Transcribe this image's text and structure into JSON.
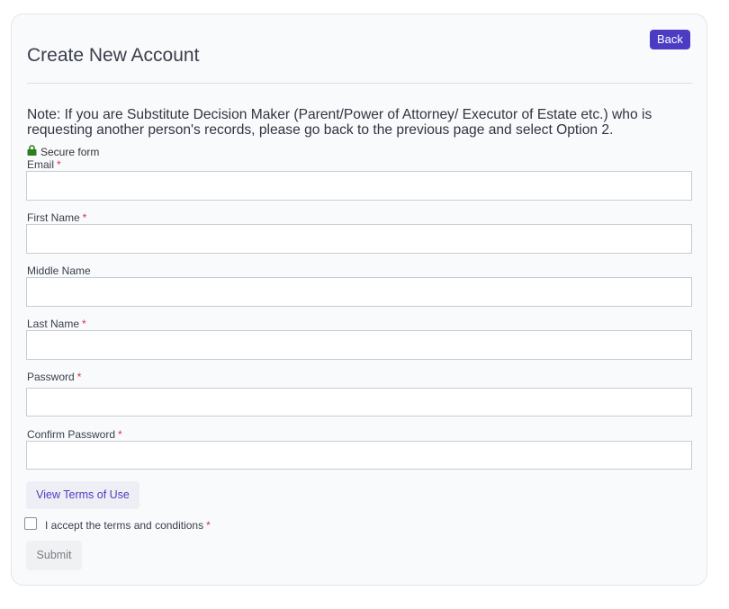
{
  "header": {
    "title": "Create New Account",
    "back_label": "Back"
  },
  "note": "Note: If you are Substitute Decision Maker (Parent/Power of Attorney/ Executor of Estate etc.) who is requesting another person's records, please go back to the previous page and select Option 2.",
  "secure_label": "Secure form",
  "required_marker": "*",
  "fields": {
    "email": {
      "label": "Email",
      "value": ""
    },
    "first_name": {
      "label": "First Name",
      "value": ""
    },
    "middle_name": {
      "label": "Middle Name",
      "value": ""
    },
    "last_name": {
      "label": "Last Name",
      "value": ""
    },
    "password": {
      "label": "Password",
      "value": ""
    },
    "confirm_password": {
      "label": "Confirm Password",
      "value": ""
    }
  },
  "terms_button_label": "View Terms of Use",
  "accept_label": "I accept the terms and conditions",
  "submit_label": "Submit",
  "colors": {
    "accent": "#4b3cc4",
    "required": "#d9304b",
    "lock": "#2e7d1e"
  }
}
